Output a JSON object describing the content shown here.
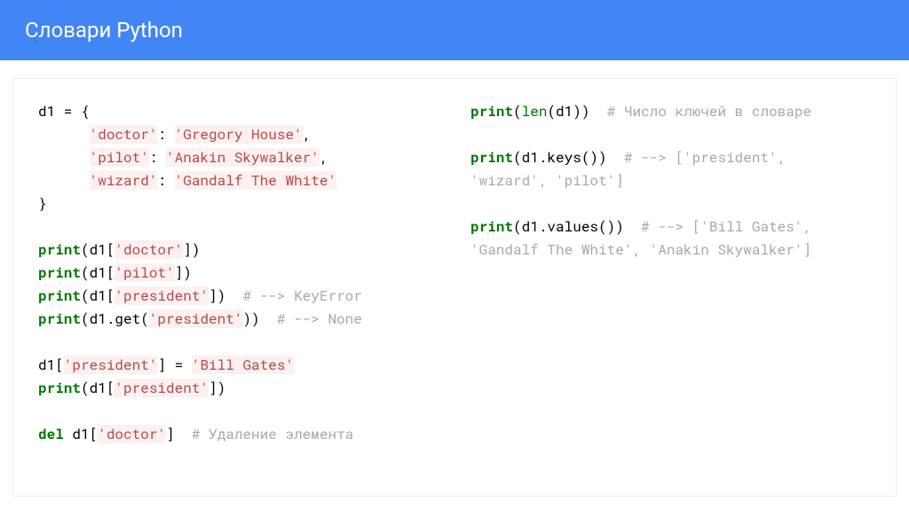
{
  "header": {
    "title": "Словари Python"
  },
  "left": {
    "l1": "d1 = {",
    "l2a": "      ",
    "l2s": "'doctor'",
    "l2b": ": ",
    "l2c": "'Gregory House'",
    "l2d": ",",
    "l3a": "      ",
    "l3s": "'pilot'",
    "l3b": ": ",
    "l3c": "'Anakin Skywalker'",
    "l3d": ",",
    "l4a": "      ",
    "l4s": "'wizard'",
    "l4b": ": ",
    "l4c": "'Gandalf The White'",
    "l5": "}",
    "p1a": "print",
    "p1b": "(d1[",
    "p1s": "'doctor'",
    "p1c": "])",
    "p2a": "print",
    "p2b": "(d1[",
    "p2s": "'pilot'",
    "p2c": "])",
    "p3a": "print",
    "p3b": "(d1[",
    "p3s": "'president'",
    "p3c": "])",
    "p3d": "  ",
    "p3e": "# --> KeyError",
    "p4a": "print",
    "p4b": "(d1.get(",
    "p4s": "'president'",
    "p4c": "))",
    "p4d": "  ",
    "p4e": "# --> None",
    "asA": "d1[",
    "asS": "'president'",
    "asB": "] = ",
    "asC": "'Bill Gates'",
    "p5a": "print",
    "p5b": "(d1[",
    "p5s": "'president'",
    "p5c": "])",
    "dlA": "del",
    "dlB": " d1[",
    "dlS": "'doctor'",
    "dlC": "]",
    "dlD": "  ",
    "dlE": "# Удаление элемента"
  },
  "right": {
    "r1a": "print",
    "r1b": "(",
    "r1f": "len",
    "r1c": "(d1))",
    "r1d": "  ",
    "r1e": "# Число ключей в словаре",
    "r2a": "print",
    "r2b": "(d1.keys())",
    "r2c": "  ",
    "r2d": "# --> ['president', 'wizard', 'pilot']",
    "r3a": "print",
    "r3b": "(d1.values())",
    "r3c": "  ",
    "r3d": "# --> ['Bill Gates', 'Gandalf The White', 'Anakin Skywalker']"
  }
}
